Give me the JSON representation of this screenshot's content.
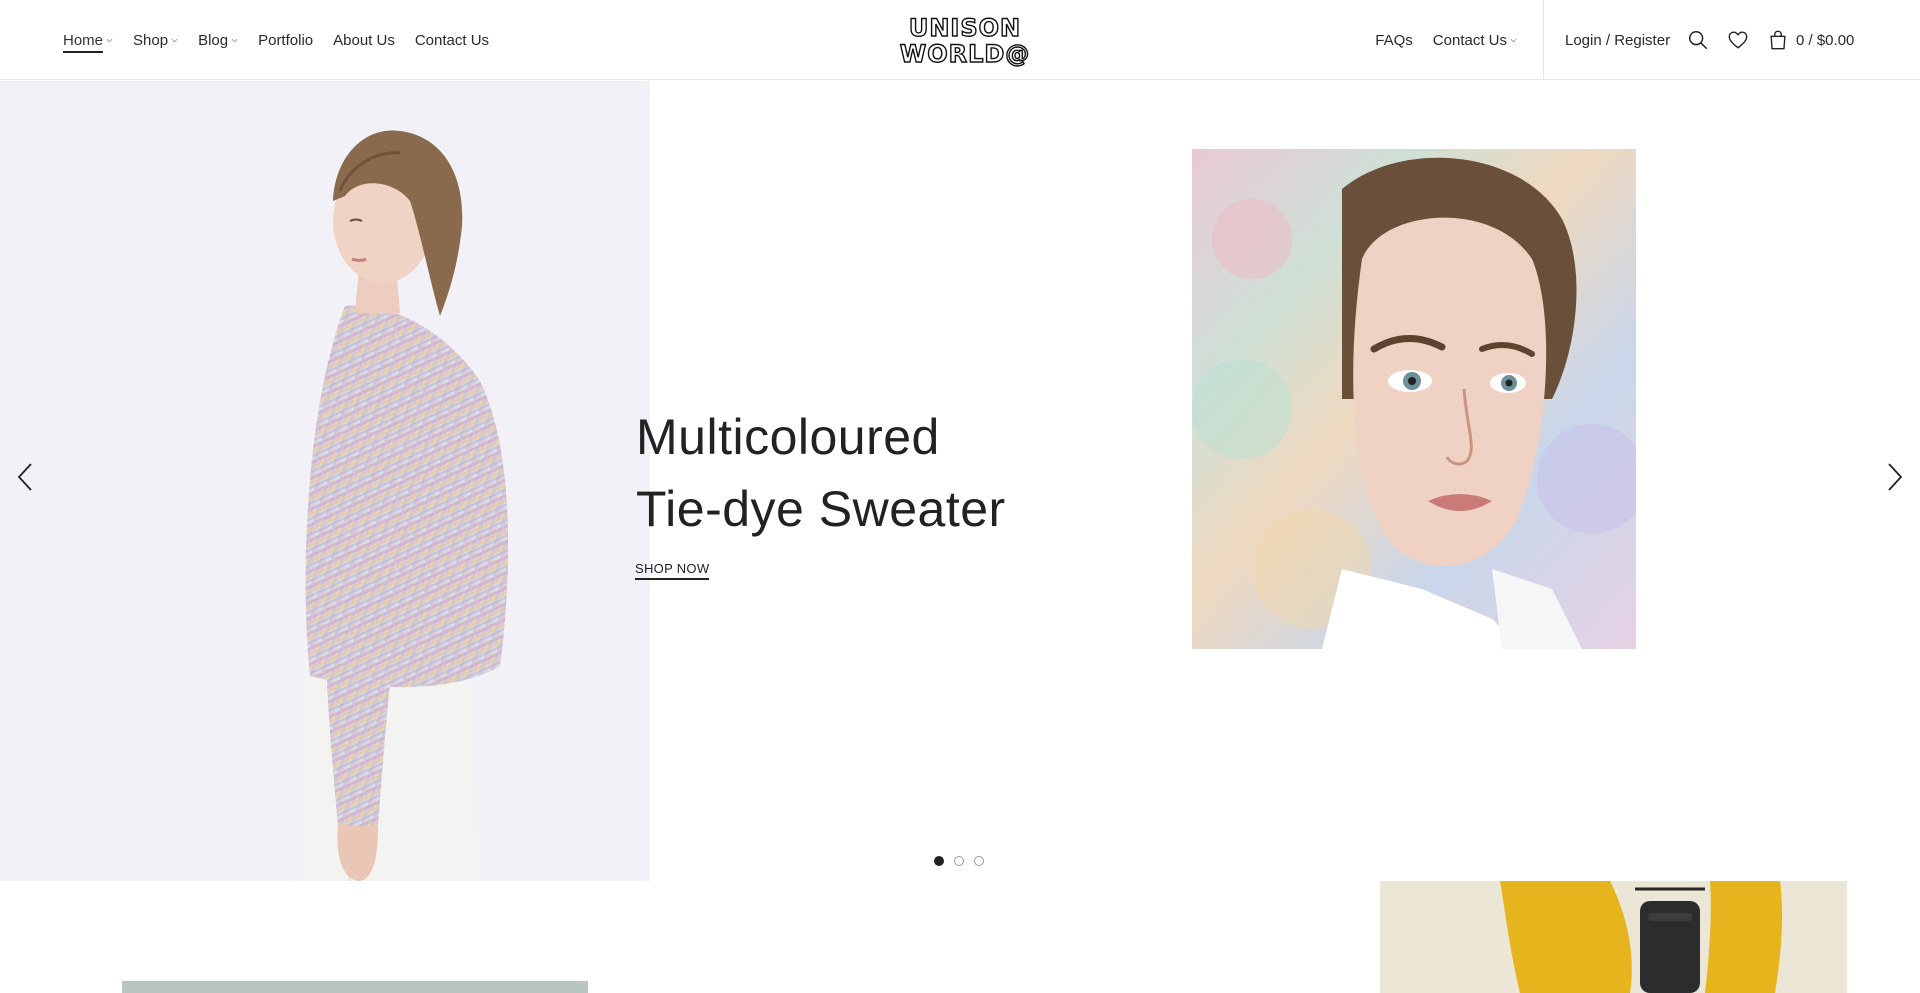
{
  "header": {
    "nav_left": [
      {
        "label": "Home",
        "has_caret": true,
        "active": true
      },
      {
        "label": "Shop",
        "has_caret": true
      },
      {
        "label": "Blog",
        "has_caret": true
      },
      {
        "label": "Portfolio",
        "has_caret": false
      },
      {
        "label": "About Us",
        "has_caret": false
      },
      {
        "label": "Contact Us",
        "has_caret": false
      }
    ],
    "logo": {
      "line1": "UNISON",
      "line2": "WORLD@"
    },
    "nav_right": [
      {
        "label": "FAQs",
        "has_caret": false
      },
      {
        "label": "Contact Us",
        "has_caret": true
      }
    ],
    "account_label": "Login / Register",
    "icons": {
      "search": "search-icon",
      "wishlist": "heart-icon",
      "cart": "shopping-bag-icon"
    },
    "cart_total": "0 / $0.00"
  },
  "hero": {
    "title_line1": "Multicoloured",
    "title_line2": "Tie-dye Sweater",
    "cta": "SHOP NOW",
    "slides_count": 3,
    "active_slide": 1,
    "icons": {
      "prev": "chevron-left-icon",
      "next": "chevron-right-icon"
    }
  },
  "colors": {
    "text": "#222222",
    "hero_left_bg": "#f2f1f7",
    "promo_right_bg": "#ece6d6",
    "promo_left_bg": "#b9c4c3"
  }
}
